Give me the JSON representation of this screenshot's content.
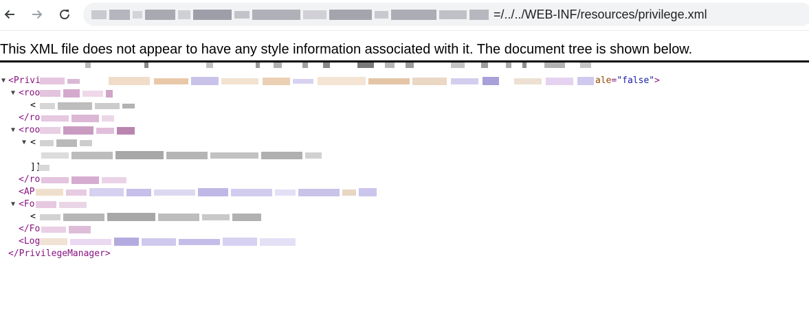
{
  "browser": {
    "back_icon": "arrow-left-icon",
    "forward_icon": "arrow-right-icon",
    "reload_icon": "reload-icon",
    "url_visible_suffix": "=/../../WEB-INF/resources/privilege.xml"
  },
  "page": {
    "notice": "This XML file does not appear to have any style information associated with it. The document tree is shown below."
  },
  "xml_tree": {
    "toggle_glyph": "▼",
    "root_open_prefix": "<Privi",
    "root_attr_tail_name": "ale",
    "root_attr_value": "\"false\"",
    "root_open_suffix": ">",
    "line2_tag": "<roo",
    "line3_text": "<",
    "line4_tag": "</ro",
    "line5_tag": "<roo",
    "line6_text": "<",
    "line8_text": "]]",
    "line9_tag": "</ro",
    "line10_tag": "<AP",
    "line11_tag": "<Fo",
    "line12_text": "<",
    "line13_tag": "</Fo",
    "line14_tag": "<Log",
    "root_close": "</PrivilegeManager>"
  },
  "colors": {
    "tag": "#881280",
    "attr_name": "#994500",
    "attr_value": "#1a1aa6"
  }
}
